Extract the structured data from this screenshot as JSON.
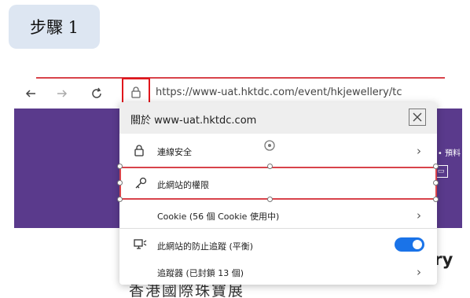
{
  "step": {
    "label": "步驟 1"
  },
  "browser": {
    "url": "https://www-uat.hktdc.com/event/hkjewellery/tc",
    "back_icon": "back-arrow-icon",
    "forward_icon": "forward-arrow-icon",
    "refresh_icon": "refresh-icon",
    "lock_icon": "lock-icon"
  },
  "popup": {
    "title": "關於 www-uat.hktdc.com",
    "rows": [
      {
        "label": "連線安全",
        "icon": "lock-icon"
      },
      {
        "label": "此網站的權限",
        "icon": "key-icon"
      },
      {
        "label": "Cookie (56 個 Cookie 使用中)"
      },
      {
        "label": "此網站的防止追蹤 (平衡)",
        "icon": "tracking-prevention-icon",
        "toggle_on": true
      },
      {
        "label": "追蹤器 (已封鎖 13 個)"
      }
    ]
  },
  "page_behind": {
    "right_text": "熱 • 預料",
    "heading_partial": "ery S",
    "chinese_partial": "香港國際珠寶展"
  },
  "colors": {
    "accent_red": "#d8434b",
    "purple_band": "#5a3a8c",
    "toggle_blue": "#1a73e8",
    "step_badge_bg": "#dde6f2"
  }
}
